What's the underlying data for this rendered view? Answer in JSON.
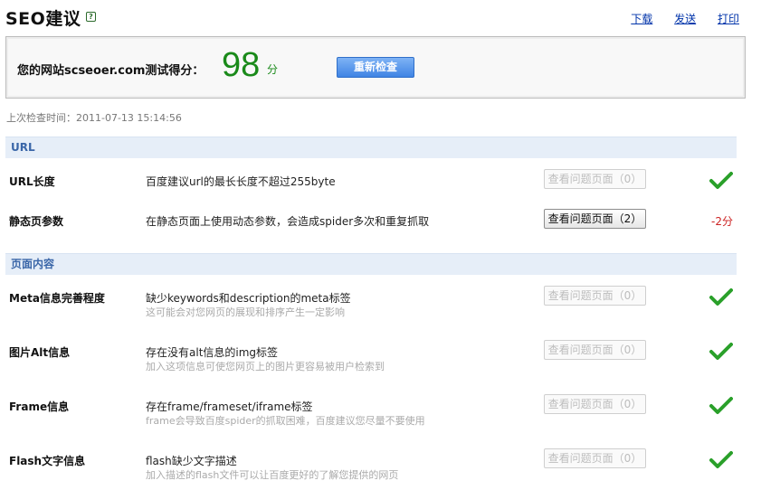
{
  "header": {
    "title": "SEO建议",
    "help_glyph": "?",
    "links": {
      "download": "下载",
      "send": "发送",
      "print": "打印"
    }
  },
  "score": {
    "label": "您的网站scseoer.com测试得分：",
    "value": "98",
    "unit": "分",
    "recheck_label": "重新检查"
  },
  "last_check": "上次检查时间：2011-07-13 15:14:56",
  "sections": [
    {
      "heading": "URL",
      "rows": [
        {
          "name": "URL长度",
          "desc": "百度建议url的最长长度不超过255byte",
          "sub": "",
          "button": "查看问题页面（0）",
          "button_enabled": false,
          "status": "check-icon"
        },
        {
          "name": "静态页参数",
          "desc": "在静态页面上使用动态参数，会造成spider多次和重复抓取",
          "sub": "",
          "button": "查看问题页面（2）",
          "button_enabled": true,
          "status": "-2分"
        }
      ]
    },
    {
      "heading": "页面内容",
      "rows": [
        {
          "name": "Meta信息完善程度",
          "desc": "缺少keywords和description的meta标签",
          "sub": "这可能会对您网页的展现和排序产生一定影响",
          "button": "查看问题页面（0）",
          "button_enabled": false,
          "status": "check-icon"
        },
        {
          "name": "图片Alt信息",
          "desc": "存在没有alt信息的img标签",
          "sub": "加入这项信息可使您网页上的图片更容易被用户检索到",
          "button": "查看问题页面（0）",
          "button_enabled": false,
          "status": "check-icon"
        },
        {
          "name": "Frame信息",
          "desc": "存在frame/frameset/iframe标签",
          "sub": "frame会导致百度spider的抓取困难，百度建议您尽量不要使用",
          "button": "查看问题页面（0）",
          "button_enabled": false,
          "status": "check-icon"
        },
        {
          "name": "Flash文字信息",
          "desc": "flash缺少文字描述",
          "sub": "加入描述的flash文件可以让百度更好的了解您提供的网页",
          "button": "查看问题页面（0）",
          "button_enabled": false,
          "status": "check-icon"
        }
      ]
    }
  ],
  "colors": {
    "accent_green": "#1a8a1a",
    "penalty_red": "#cc2222",
    "section_bg": "#e6eef8",
    "link_blue": "#0033aa"
  }
}
